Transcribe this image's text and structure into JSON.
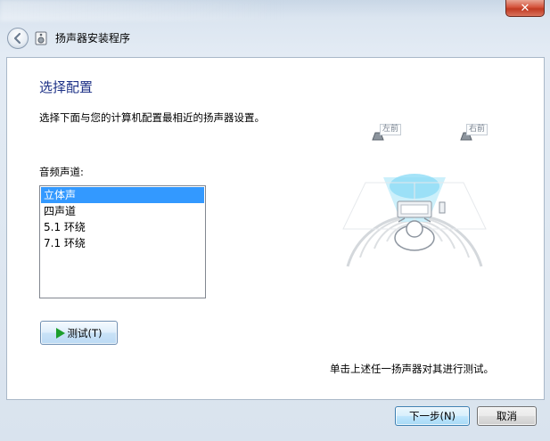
{
  "window": {
    "title": "扬声器安装程序",
    "close_symbol": "✕"
  },
  "page": {
    "title": "选择配置",
    "instruction": "选择下面与您的计算机配置最相近的扬声器设置。"
  },
  "channels": {
    "label": "音频声道:",
    "items": [
      {
        "label": "立体声",
        "selected": true
      },
      {
        "label": "四声道",
        "selected": false
      },
      {
        "label": "5.1 环绕",
        "selected": false
      },
      {
        "label": "7.1 环绕",
        "selected": false
      }
    ]
  },
  "test_button": {
    "label": "测试(T)",
    "icon": "play-icon"
  },
  "diagram": {
    "left_speaker_label": "左前",
    "right_speaker_label": "右前"
  },
  "hint": "单击上述任一扬声器对其进行测试。",
  "footer": {
    "next_label": "下一步(N)",
    "cancel_label": "取消"
  },
  "colors": {
    "selection": "#3399ff",
    "title_blue": "#1e3287",
    "play_green": "#1c9e2c"
  }
}
